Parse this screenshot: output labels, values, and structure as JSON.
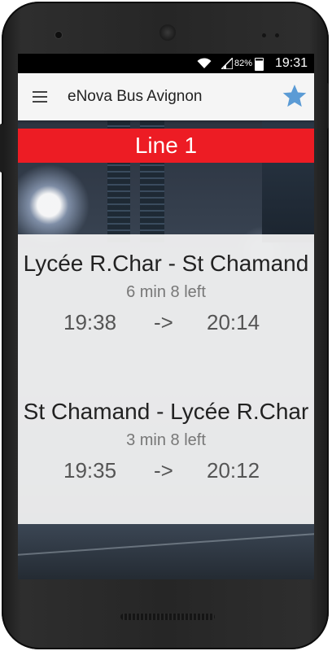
{
  "status_bar": {
    "battery_percent": "82%",
    "time": "19:31"
  },
  "app_bar": {
    "title": "eNova Bus Avignon",
    "menu_icon": "hamburger-menu-icon",
    "favorite_icon": "star-icon",
    "star_color": "#5b9bd5"
  },
  "line": {
    "label": "Line 1",
    "color": "#ed1c24"
  },
  "routes": [
    {
      "name": "Lycée R.Char - St Chamand",
      "time_left": "6 min 8 left",
      "departure": "19:38",
      "arrow": "->",
      "arrival": "20:14"
    },
    {
      "name": "St Chamand - Lycée R.Char",
      "time_left": "3 min 8 left",
      "departure": "19:35",
      "arrow": "->",
      "arrival": "20:12"
    }
  ]
}
